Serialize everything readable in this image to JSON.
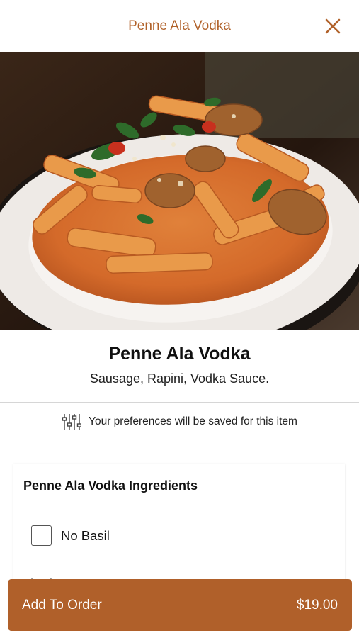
{
  "header": {
    "title": "Penne Ala Vodka",
    "close_icon": "close-icon"
  },
  "hero": {
    "alt": "photo of penne ala vodka dish"
  },
  "item": {
    "name": "Penne Ala Vodka",
    "description": "Sausage, Rapini, Vodka Sauce."
  },
  "preferences": {
    "icon": "sliders-icon",
    "text": "Your preferences will be saved for this item"
  },
  "ingredients": {
    "title": "Penne Ala Vodka Ingredients",
    "options": [
      {
        "label": "No Basil",
        "checked": false
      }
    ]
  },
  "order_button": {
    "label": "Add To Order",
    "price": "$19.00"
  },
  "colors": {
    "accent": "#b0602a",
    "title_text": "#b1622a"
  }
}
